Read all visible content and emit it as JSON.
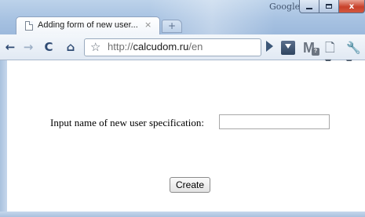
{
  "browser": {
    "brand_label": "Google",
    "tab": {
      "title": "Adding form of new user...",
      "close_glyph": "×"
    },
    "new_tab_glyph": "+",
    "window_controls": {
      "close_glyph": "x"
    },
    "toolbar": {
      "back_glyph": "←",
      "forward_glyph": "→",
      "reload_glyph": "C",
      "home_glyph": "⌂",
      "star_glyph": "☆",
      "url_scheme": "http://",
      "url_domain": "calcudom.ru",
      "url_path": "/en",
      "gmail_glyph": "M",
      "gmail_badge": "?",
      "page_menu_glyph": "🗋▾",
      "wrench_glyph": "🔧▾"
    },
    "icons": {
      "back": "back-arrow-icon",
      "forward": "forward-arrow-icon",
      "reload": "reload-icon",
      "home": "home-icon",
      "star": "star-icon",
      "go": "go-arrow-icon",
      "download": "download-icon",
      "gmail": "gmail-icon",
      "page_menu": "page-menu-icon",
      "wrench": "wrench-icon"
    }
  },
  "form": {
    "label": "Input name of new user specification:",
    "input_value": "",
    "input_placeholder": "",
    "submit_label": "Create"
  }
}
